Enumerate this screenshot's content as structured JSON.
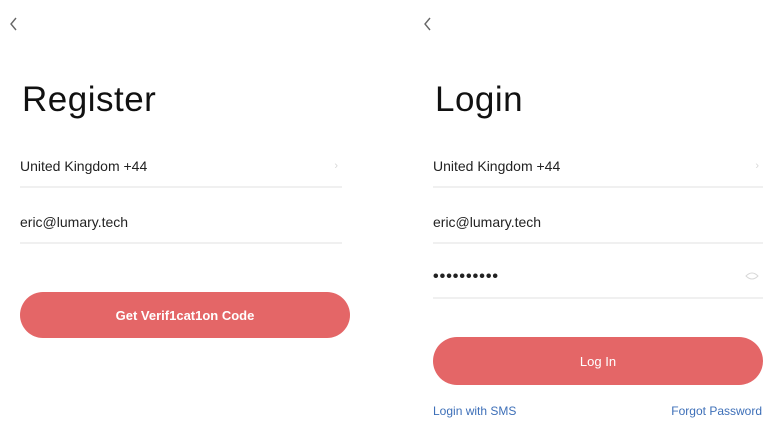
{
  "register": {
    "title": "Register",
    "country_value": "United Kingdom +44",
    "email_value": "eric@lumary.tech",
    "submit_label": "Get Verif1cat1on  Code"
  },
  "login": {
    "title": "Login",
    "country_value": "United Kingdom +44",
    "email_value": "eric@lumary.tech",
    "password_mask": "••••••••••",
    "submit_label": "Log In",
    "sms_link": "Login with SMS",
    "forgot_link": "Forgot Password"
  },
  "icons": {
    "back": "chevron-left-icon",
    "country_trail": "chevron-right-icon",
    "password_trail": "eye-icon"
  },
  "colors": {
    "accent": "#e46667",
    "link": "#3d6fb8",
    "divider": "#f0f0f0"
  }
}
